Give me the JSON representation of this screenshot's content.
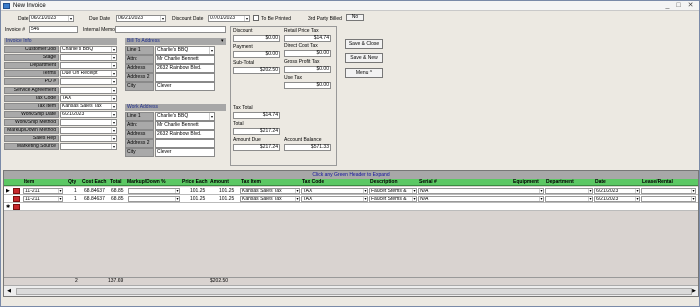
{
  "window": {
    "title": "New Invoice",
    "controls": [
      "_",
      "□",
      "✕"
    ]
  },
  "header": {
    "date_label": "Date",
    "date": "06/21/2023",
    "due_date_label": "Due Date",
    "due_date": "06/21/2023",
    "discount_date_label": "Discount Date",
    "discount_date": "07/01/2023",
    "to_be_printed_label": "To Be Printed",
    "third_party_label": "3rd Party Billed",
    "third_party_value": "No",
    "invoice_label": "Invoice #",
    "invoice_no": "546",
    "internal_memo_label": "Internal Memo",
    "internal_memo": ""
  },
  "invoice_info": {
    "heading": "Invoice Info",
    "fields": [
      {
        "label": "Customer:Job",
        "value": "Charlie's BBQ"
      },
      {
        "label": "Stage",
        "value": ""
      },
      {
        "label": "Department",
        "value": ""
      },
      {
        "label": "Terms",
        "value": "Due On Receipt"
      },
      {
        "label": "PO #",
        "value": ""
      },
      {
        "label": "Service Agreement",
        "value": ""
      },
      {
        "label": "Tax Code",
        "value": "TAX"
      },
      {
        "label": "Tax Item",
        "value": "Kansas Sales Tax"
      },
      {
        "label": "Work/Ship Date",
        "value": "6/21/2023"
      },
      {
        "label": "Work/Ship Method",
        "value": ""
      },
      {
        "label": "Markup/Down Method",
        "value": ""
      },
      {
        "label": "Sales Rep",
        "value": ""
      },
      {
        "label": "Marketing Source",
        "value": ""
      }
    ]
  },
  "bill_to": {
    "heading": "Bill To Address",
    "lines": [
      {
        "label": "Line 1",
        "value": "Charlie's BBQ"
      },
      {
        "label": "Attn:",
        "value": "Mr Charlie Bennett"
      },
      {
        "label": "Address",
        "value": "2632 Rainbow Blvd."
      },
      {
        "label": "Address 2",
        "value": ""
      },
      {
        "label": "City",
        "value": "Clever"
      }
    ]
  },
  "work_address": {
    "heading": "Work Address",
    "lines": [
      {
        "label": "Line 1",
        "value": "Charlie's BBQ"
      },
      {
        "label": "Attn:",
        "value": "Mr Charlie Bennett"
      },
      {
        "label": "Address",
        "value": "2632 Rainbow Blvd."
      },
      {
        "label": "Address 2",
        "value": ""
      },
      {
        "label": "City",
        "value": "Clever"
      }
    ]
  },
  "summary": {
    "discount_label": "Discount",
    "discount": "$0.00",
    "payment_label": "Payment",
    "payment": "$0.00",
    "subtotal_label": "Sub-Total",
    "subtotal": "$202.50",
    "tax_total_label": "Tax Total",
    "tax_total": "$14.74",
    "total_label": "Total",
    "total": "$217.24",
    "amount_due_label": "Amount Due",
    "amount_due": "$217.24",
    "retail_price_tax_label": "Retail Price Tax",
    "retail_price_tax": "$14.74",
    "direct_cost_tax_label": "Direct Cost Tax",
    "direct_cost_tax": "$0.00",
    "gross_profit_tax_label": "Gross Profit Tax",
    "gross_profit_tax": "$0.00",
    "use_tax_label": "Use Tax",
    "use_tax": "$0.00",
    "account_balance_label": "Account Balance",
    "account_balance": "$571.33"
  },
  "buttons": {
    "save_close": "Save & Close",
    "save_new": "Save & New",
    "menu": "Menu ^"
  },
  "grid": {
    "banner": "Click any Green Header to Expand",
    "columns": [
      "Item",
      "Qty",
      "Cost Each",
      "Total",
      "Markup/Down %",
      "Price Each",
      "Amount",
      "Tax Item",
      "Tax Code",
      "Description",
      "Serial #",
      "Equipment",
      "Department",
      "Date",
      "Lease/Rental"
    ],
    "rows": [
      {
        "item": "11-211",
        "qty": "1",
        "cost": "68.84637",
        "total": "68.85",
        "price": "101.25",
        "amount": "101.25",
        "tax_item": "Kansas Sales Tax",
        "tax_code": "TAX",
        "description": "Faucet Stems &",
        "serial": "N/A",
        "date": "6/21/2023"
      },
      {
        "item": "11-211",
        "qty": "1",
        "cost": "68.84637",
        "total": "68.85",
        "price": "101.25",
        "amount": "101.25",
        "tax_item": "Kansas Sales Tax",
        "tax_code": "TAX",
        "description": "Faucet Stems &",
        "serial": "N/A",
        "date": "6/21/2023"
      }
    ],
    "footer": {
      "qty_total": "2",
      "total_sum": "137.69",
      "amount_sum": "$202.50"
    }
  },
  "colors": {
    "grid_header": "#5cc864",
    "panel_header": "#a7a7a7",
    "label_bg": "#a9a9a9"
  }
}
